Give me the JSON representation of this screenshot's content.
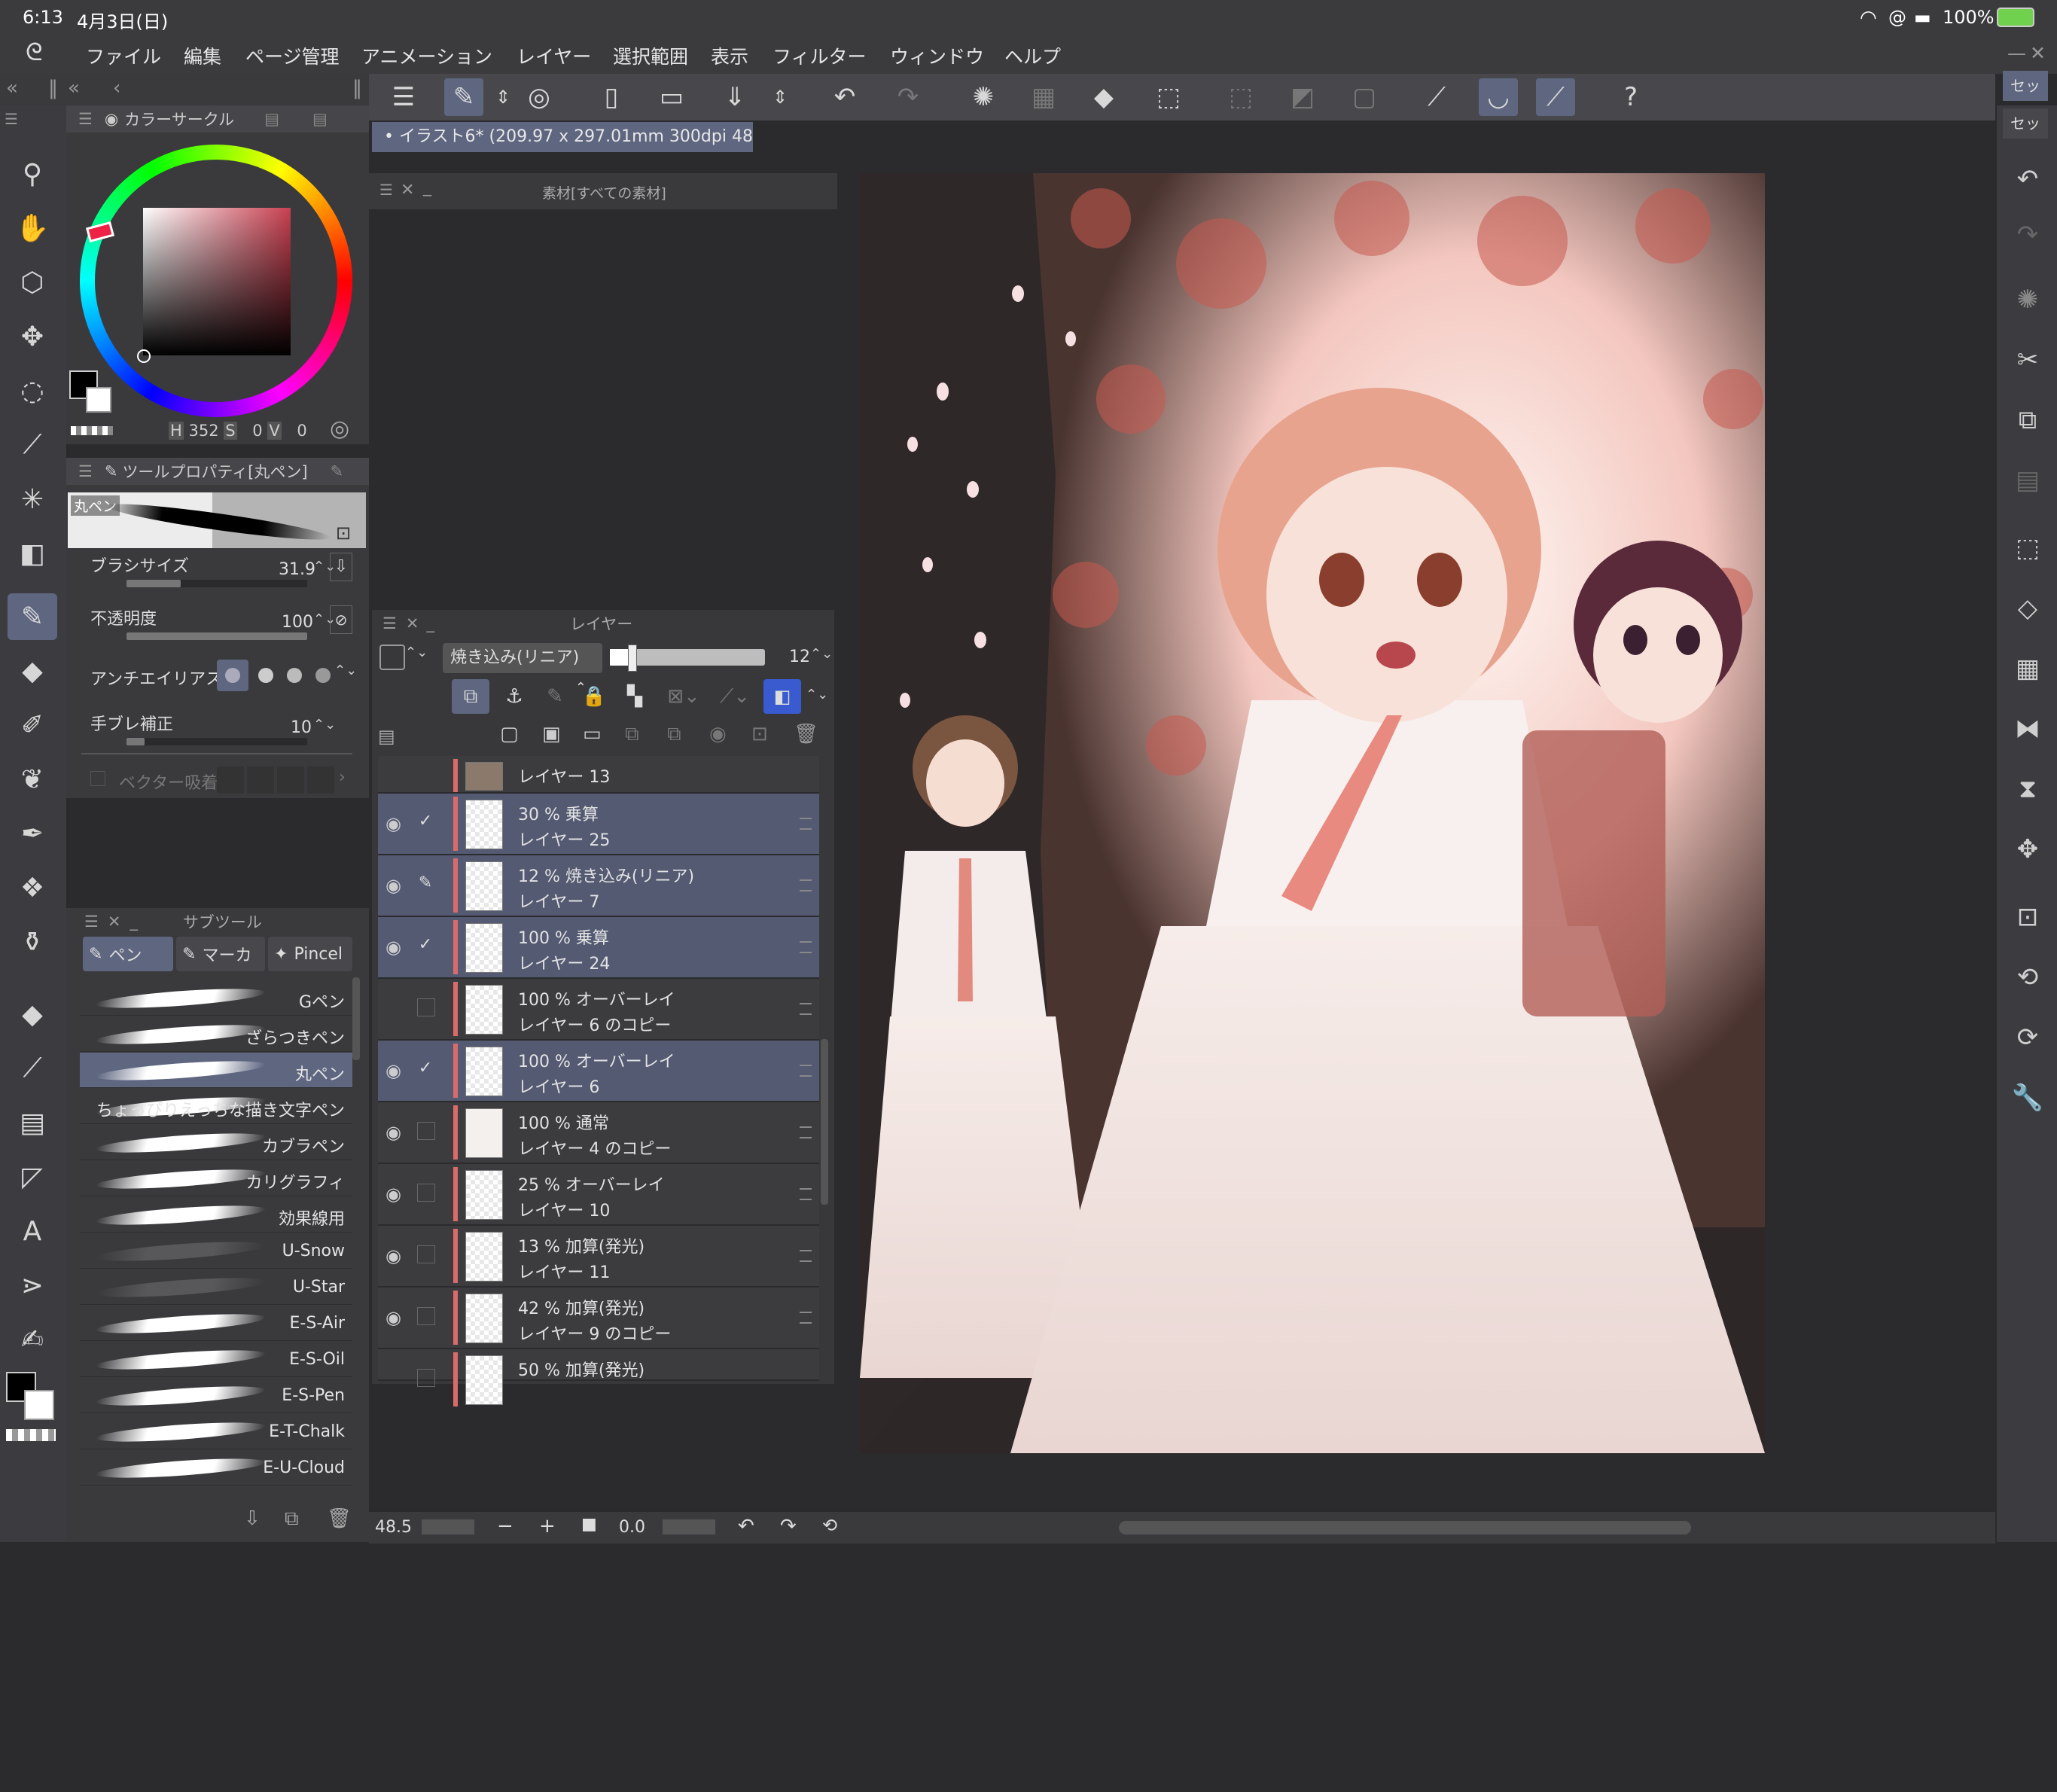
{
  "status": {
    "time": "6:13",
    "date": "4月3日(日)",
    "battery": "100%"
  },
  "menu": [
    "ファイル",
    "編集",
    "ページ管理",
    "アニメーション",
    "レイヤー",
    "選択範囲",
    "表示",
    "フィルター",
    "ウィンドウ",
    "ヘルプ"
  ],
  "document_tab": "イラスト6* (209.97 x 297.01mm 300dpi 48.5%)",
  "material_panel": {
    "title": "素材[すべての素材]"
  },
  "color_panel": {
    "title": "カラーサークル",
    "h": "352",
    "s": "0",
    "v": "0",
    "h_label": "H",
    "s_label": "S",
    "v_label": "V",
    "base_color": "#c84050"
  },
  "tool_property": {
    "title": "ツールプロパティ[丸ペン]",
    "preset": "丸ペン",
    "brush_size_label": "ブラシサイズ",
    "brush_size": "31.9",
    "brush_size_pct": 0.3,
    "opacity_label": "不透明度",
    "opacity": "100",
    "opacity_pct": 1.0,
    "antialias_label": "アンチエイリアス",
    "stabilization_label": "手ブレ補正",
    "stabilization": "10",
    "stabilization_pct": 0.1,
    "vector_label": "ベクター吸着"
  },
  "subtool": {
    "title": "サブツール",
    "tabs": [
      "ペン",
      "マーカ",
      "Pincel"
    ],
    "items": [
      "Gペン",
      "ざらつきペン",
      "丸ペン",
      "ちょっぴりえっちな描き文字ペン",
      "カブラペン",
      "カリグラフィ",
      "効果線用",
      "U-Snow",
      "U-Star",
      "E-S-Air",
      "E-S-Oil",
      "E-S-Pen",
      "E-T-Chalk",
      "E-U-Cloud"
    ],
    "selected": "丸ペン"
  },
  "layer_panel": {
    "title": "レイヤー",
    "blend_mode": "焼き込み(リニア)",
    "opacity": "12",
    "layers": [
      {
        "mode": "",
        "name": "レイヤー 13",
        "visible": true,
        "checked": false,
        "selected": false
      },
      {
        "mode": "30 %  乗算",
        "name": "レイヤー 25",
        "visible": true,
        "checked": true,
        "selected": true
      },
      {
        "mode": "12 %  焼き込み(リニア)",
        "name": "レイヤー 7",
        "visible": true,
        "checked": false,
        "pen": true,
        "selected": true
      },
      {
        "mode": "100 %  乗算",
        "name": "レイヤー 24",
        "visible": true,
        "checked": true,
        "selected": true
      },
      {
        "mode": "100 %  オーバーレイ",
        "name": "レイヤー 6 のコピー",
        "visible": false,
        "checked": false,
        "selected": false
      },
      {
        "mode": "100 %  オーバーレイ",
        "name": "レイヤー 6",
        "visible": true,
        "checked": true,
        "selected": true
      },
      {
        "mode": "100 %  通常",
        "name": "レイヤー 4 のコピー",
        "visible": true,
        "checked": false,
        "selected": false
      },
      {
        "mode": "25 %  オーバーレイ",
        "name": "レイヤー 10",
        "visible": true,
        "checked": false,
        "selected": false
      },
      {
        "mode": "13 %  加算(発光)",
        "name": "レイヤー 11",
        "visible": true,
        "checked": false,
        "selected": false
      },
      {
        "mode": "42 %  加算(発光)",
        "name": "レイヤー 9 のコピー",
        "visible": true,
        "checked": false,
        "selected": false
      },
      {
        "mode": "50 %  加算(発光)",
        "name": "",
        "visible": false,
        "checked": false,
        "selected": false
      }
    ]
  },
  "right_tabs": [
    "セッ",
    "セッ"
  ],
  "bottom": {
    "zoom": "48.5",
    "rotation": "0.0"
  }
}
